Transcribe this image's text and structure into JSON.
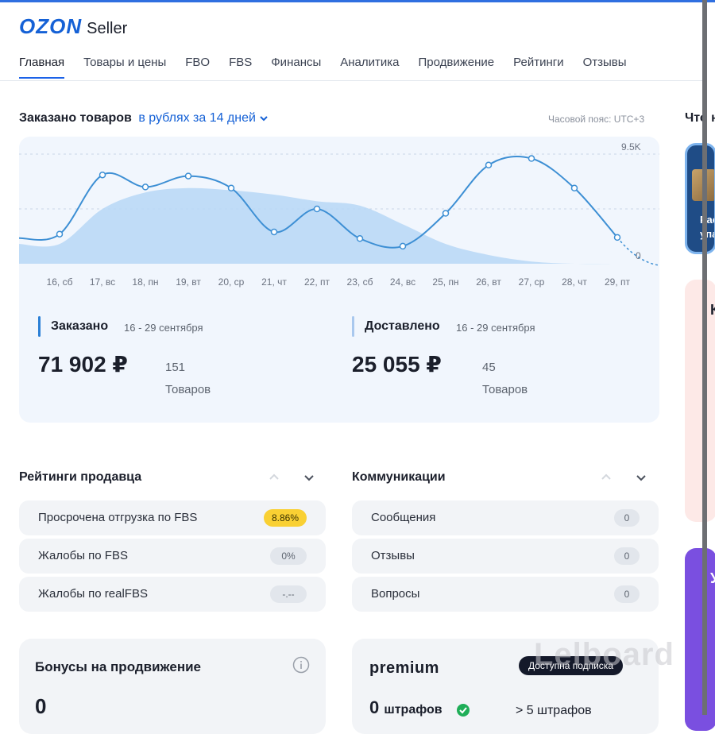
{
  "header": {
    "logo": "OZON",
    "logo_sub": "Seller"
  },
  "nav": [
    {
      "label": "Главная"
    },
    {
      "label": "Товары и цены"
    },
    {
      "label": "FBO"
    },
    {
      "label": "FBS"
    },
    {
      "label": "Финансы"
    },
    {
      "label": "Аналитика"
    },
    {
      "label": "Продвижение"
    },
    {
      "label": "Рейтинги"
    },
    {
      "label": "Отзывы"
    }
  ],
  "orders": {
    "title": "Заказано товаров",
    "period_selector": "в рублях за 14 дней",
    "timezone": "Часовой пояс: UTC+3",
    "side_title_cut": "Что н"
  },
  "chart_data": {
    "type": "line",
    "categories": [
      "16, сб",
      "17, вс",
      "18, пн",
      "19, вт",
      "20, ср",
      "21, чт",
      "22, пт",
      "23, сб",
      "24, вс",
      "25, пн",
      "26, вт",
      "27, ср",
      "28, чт",
      "29, пт"
    ],
    "series": [
      {
        "values": [
          2700,
          8100,
          7000,
          8000,
          6900,
          2900,
          5000,
          2300,
          1600,
          4600,
          9000,
          9600,
          6900,
          2400
        ]
      }
    ],
    "area_series": [
      1800,
      5000,
      6500,
      6900,
      6700,
      6300,
      5700,
      5300,
      3600,
      1800,
      800,
      200,
      0,
      0
    ],
    "ylim": [
      0,
      10000
    ],
    "ytick_labels": [
      "9.5K",
      "0"
    ],
    "grid": true
  },
  "stats": {
    "ordered": {
      "label": "Заказано",
      "dates": "16 - 29 сентября",
      "amount": "71 902 ₽",
      "count": "151",
      "unit": "Товаров"
    },
    "delivered": {
      "label": "Доставлено",
      "dates": "16 - 29 сентября",
      "amount": "25 055 ₽",
      "count": "45",
      "unit": "Товаров"
    }
  },
  "ratings": {
    "title": "Рейтинги продавца",
    "rows": [
      {
        "label": "Просрочена отгрузка по FBS",
        "value": "8.86%"
      },
      {
        "label": "Жалобы по FBS",
        "value": "0%"
      },
      {
        "label": "Жалобы по realFBS",
        "value": "-.--"
      }
    ]
  },
  "communications": {
    "title": "Коммуникации",
    "rows": [
      {
        "label": "Сообщения",
        "value": "0"
      },
      {
        "label": "Отзывы",
        "value": "0"
      },
      {
        "label": "Вопросы",
        "value": "0"
      }
    ]
  },
  "bonuses": {
    "title": "Бонусы на продвижение",
    "value": "0"
  },
  "premium": {
    "logo": "premium",
    "badge": "Доступна подписка",
    "fines_value": "0",
    "fines_unit": "штрафов",
    "fines_more": "> 5 штрафов"
  },
  "side_cards": {
    "card1_text1": "Рас",
    "card1_text2": "упа",
    "card2_heading": "К",
    "card3_heading": "У"
  },
  "watermark": "Lelboard",
  "colors": {
    "accent": "#1561d6",
    "line": "#3d8fd4",
    "area": "#b7d7f6",
    "warn_badge": "#f9d033"
  }
}
